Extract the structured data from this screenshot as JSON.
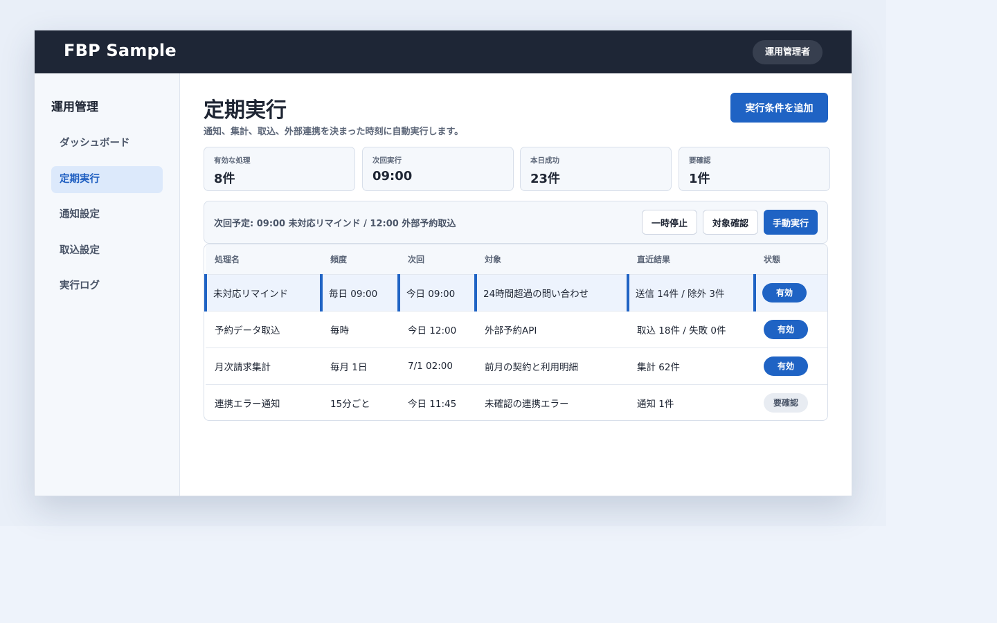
{
  "app": {
    "brand": "FBP Sample",
    "role": "運用管理者"
  },
  "sidebar": {
    "title": "運用管理",
    "items": [
      {
        "label": "ダッシュボード",
        "active": false
      },
      {
        "label": "定期実行",
        "active": true
      },
      {
        "label": "通知設定",
        "active": false
      },
      {
        "label": "取込設定",
        "active": false
      },
      {
        "label": "実行ログ",
        "active": false
      }
    ]
  },
  "page": {
    "title": "定期実行",
    "subtitle": "通知、集計、取込、外部連携を決まった時刻に自動実行します。",
    "add_button": "実行条件を追加"
  },
  "stats": [
    {
      "label": "有効な処理",
      "value": "8件"
    },
    {
      "label": "次回実行",
      "value": "09:00"
    },
    {
      "label": "本日成功",
      "value": "23件"
    },
    {
      "label": "要確認",
      "value": "1件"
    }
  ],
  "schedule": {
    "text": "次回予定: 09:00 未対応リマインド / 12:00 外部予約取込",
    "pause_button": "一時停止",
    "check_button": "対象確認",
    "run_button": "手動実行"
  },
  "table": {
    "columns": [
      "処理名",
      "頻度",
      "次回",
      "対象",
      "直近結果",
      "状態"
    ],
    "rows": [
      {
        "name": "未対応リマインド",
        "freq": "毎日 09:00",
        "next": "今日 09:00",
        "target": "24時間超過の問い合わせ",
        "result": "送信 14件 / 除外 3件",
        "status": "有効",
        "selected": true
      },
      {
        "name": "予約データ取込",
        "freq": "毎時",
        "next": "今日 12:00",
        "target": "外部予約API",
        "result": "取込 18件 / 失敗 0件",
        "status": "有効",
        "selected": false
      },
      {
        "name": "月次請求集計",
        "freq": "毎月 1日",
        "next": "7/1 02:00",
        "target": "前月の契約と利用明細",
        "result": "集計 62件",
        "status": "有効",
        "selected": false
      },
      {
        "name": "連携エラー通知",
        "freq": "15分ごと",
        "next": "今日 11:45",
        "target": "未確認の連携エラー",
        "result": "通知 1件",
        "status": "要確認",
        "selected": false
      }
    ]
  },
  "colors": {
    "accent": "#1f63c4",
    "topbar": "#1e2636",
    "active_nav_bg": "#dce9fb"
  }
}
